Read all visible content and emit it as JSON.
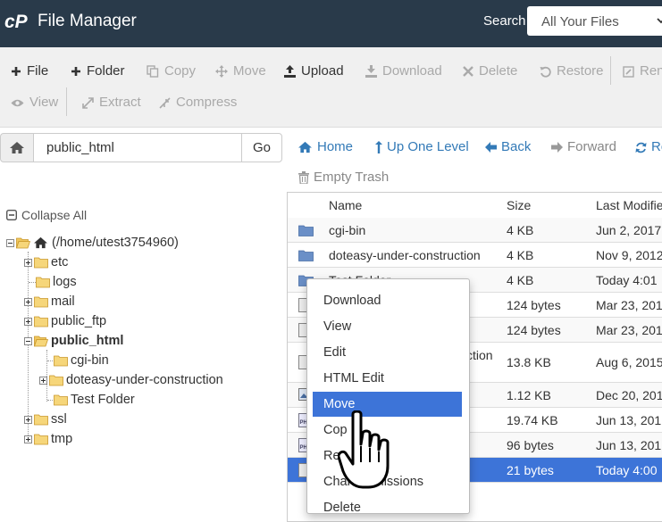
{
  "header": {
    "title": "File Manager",
    "search_label": "Search",
    "search_scope": "All Your Files",
    "bg_color": "#293a4a"
  },
  "toolbar": {
    "row1": [
      {
        "label": "File",
        "icon": "plus-icon",
        "enabled": true
      },
      {
        "label": "Folder",
        "icon": "plus-icon",
        "enabled": true
      },
      {
        "label": "Copy",
        "icon": "copy-icon",
        "enabled": false
      },
      {
        "label": "Move",
        "icon": "move-icon",
        "enabled": false
      },
      {
        "label": "Upload",
        "icon": "upload-icon",
        "enabled": true
      },
      {
        "label": "Download",
        "icon": "download-icon",
        "enabled": false
      },
      {
        "label": "Delete",
        "icon": "delete-icon",
        "enabled": false
      },
      {
        "label": "Restore",
        "icon": "restore-icon",
        "enabled": false
      },
      {
        "label": "Ren",
        "icon": "rename-icon",
        "enabled": false
      }
    ],
    "row2": [
      {
        "label": "View",
        "icon": "eye-icon",
        "enabled": false
      },
      {
        "label": "Extract",
        "icon": "expand-icon",
        "enabled": false
      },
      {
        "label": "Compress",
        "icon": "compress-icon",
        "enabled": false
      }
    ]
  },
  "path_bar": {
    "value": "public_html",
    "go_label": "Go"
  },
  "nav": {
    "home": "Home",
    "up_one_level": "Up One Level",
    "back": "Back",
    "forward": "Forward",
    "reload": "Re",
    "empty_trash": "Empty Trash"
  },
  "tree": {
    "collapse_all": "Collapse All",
    "root": "(/home/utest3754960)",
    "items": [
      {
        "label": "etc"
      },
      {
        "label": "logs"
      },
      {
        "label": "mail"
      },
      {
        "label": "public_ftp"
      },
      {
        "label": "public_html"
      },
      {
        "label": "cgi-bin"
      },
      {
        "label": "doteasy-under-construction"
      },
      {
        "label": "Test Folder"
      },
      {
        "label": "ssl"
      },
      {
        "label": "tmp"
      }
    ]
  },
  "table": {
    "columns": [
      "Name",
      "Size",
      "Last Modifie"
    ],
    "rows": [
      {
        "name": "cgi-bin",
        "size": "4 KB",
        "modified": "Jun 2, 2017"
      },
      {
        "name": "doteasy-under-construction",
        "size": "4 KB",
        "modified": "Nov 9, 2012"
      },
      {
        "name": "Test Folder",
        "size": "4 KB",
        "modified": "Today 4:01"
      },
      {
        "name": "",
        "size": "124 bytes",
        "modified": "Mar 23, 201"
      },
      {
        "name": "",
        "size": "124 bytes",
        "modified": "Mar 23, 201"
      },
      {
        "name": "ction",
        "size": "13.8 KB",
        "modified": "Aug 6, 2015"
      },
      {
        "name": "",
        "size": "1.12 KB",
        "modified": "Dec 20, 201"
      },
      {
        "name": "",
        "size": "19.74 KB",
        "modified": "Jun 13, 201"
      },
      {
        "name": "",
        "size": "96 bytes",
        "modified": "Jun 13, 201"
      },
      {
        "name": "",
        "size": "21 bytes",
        "modified": "Today 4:00"
      }
    ]
  },
  "context_menu": {
    "items": [
      {
        "label": "Download"
      },
      {
        "label": "View"
      },
      {
        "label": "Edit"
      },
      {
        "label": "HTML Edit"
      },
      {
        "label": "Move"
      },
      {
        "label": "Cop"
      },
      {
        "label": "Re"
      },
      {
        "label": "Chan  ermissions"
      },
      {
        "label": "Delete"
      }
    ],
    "active_index": 4,
    "active_color": "#3d74d8"
  }
}
